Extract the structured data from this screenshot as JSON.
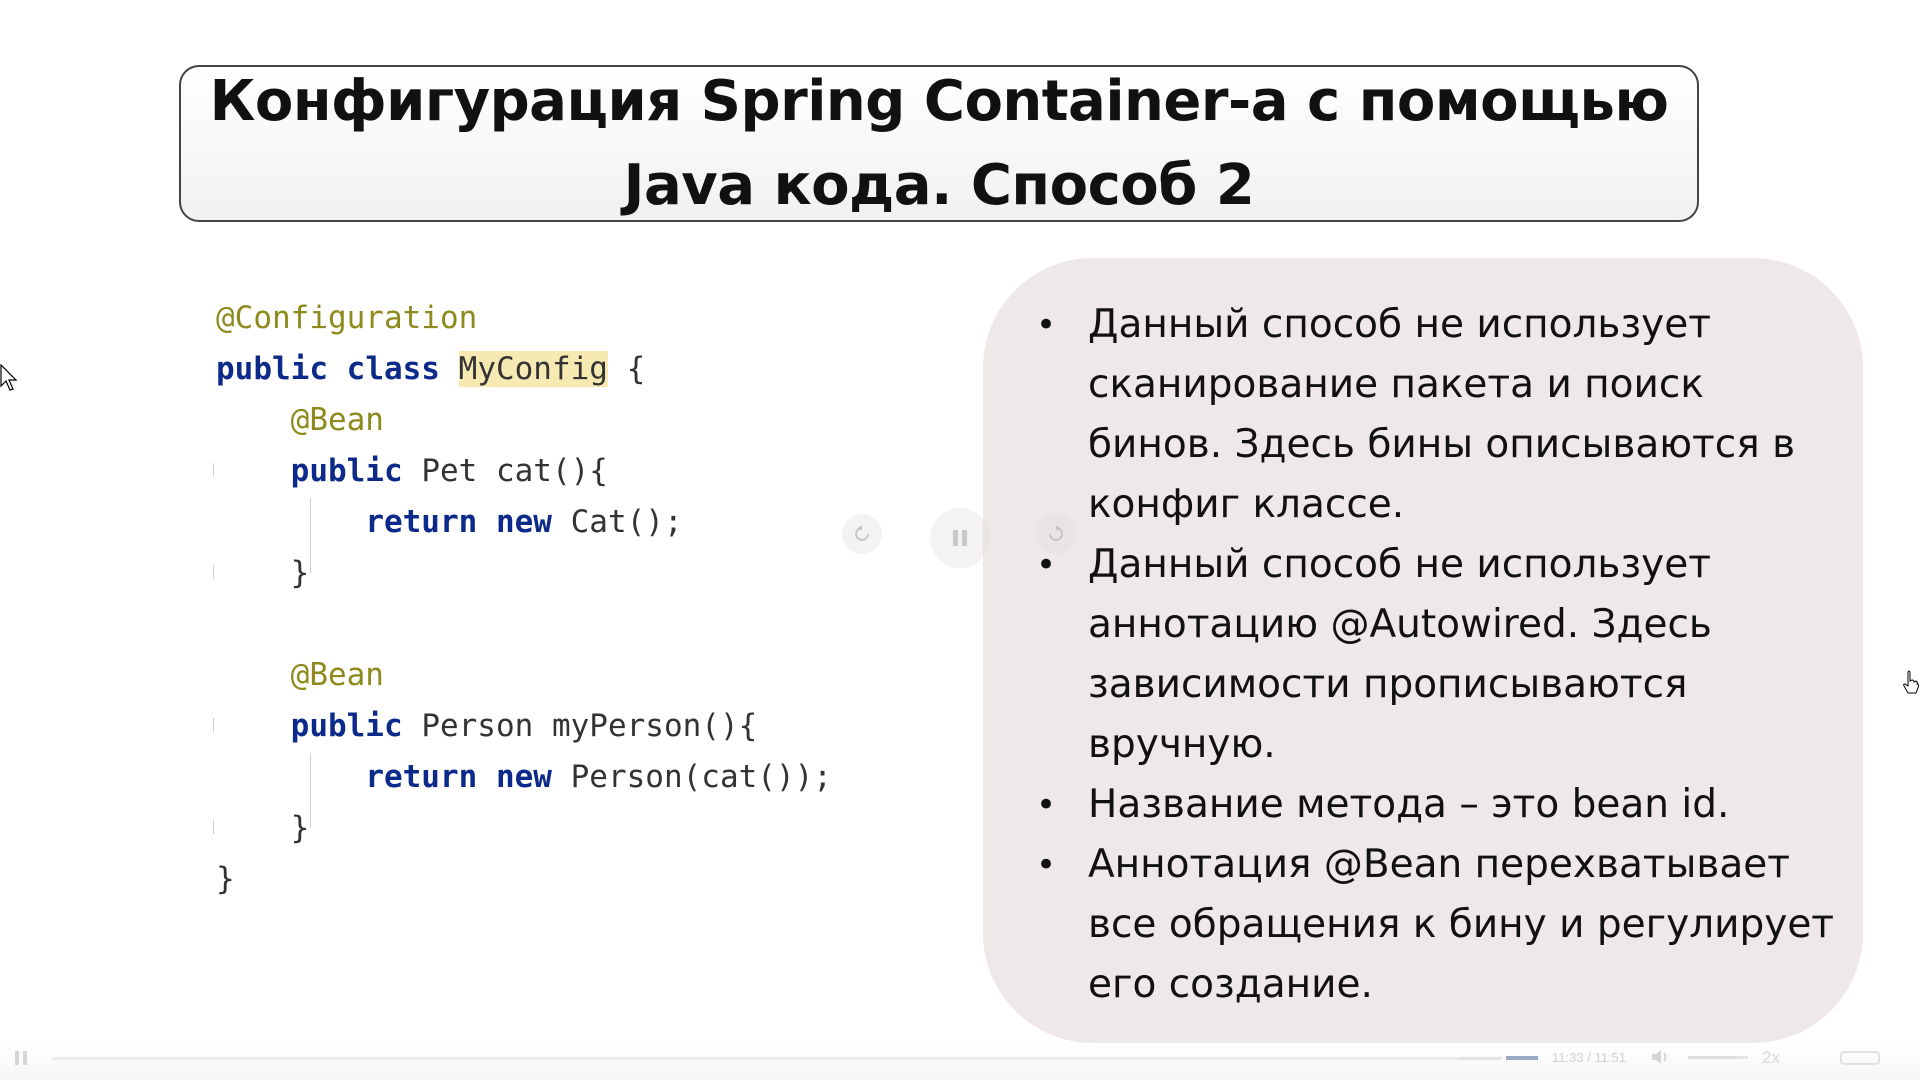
{
  "slide": {
    "title": "Конфигурация Spring Container-а с помощью\nJava кода. Способ 2",
    "code": {
      "annotation_configuration": "@Configuration",
      "kw_public": "public",
      "kw_class": "class",
      "class_name": "MyConfig",
      "open_brace": "{",
      "annotation_bean": "@Bean",
      "pet_type": "Pet",
      "method_cat": "cat(){",
      "kw_return": "return",
      "kw_new": "new",
      "cat_ctor": "Cat();",
      "close_brace": "}",
      "person_type": "Person",
      "method_person": "myPerson(){",
      "person_ctor": "Person(cat());"
    },
    "bullets": [
      "Данный способ не использует сканирование пакета и поиск бинов. Здесь бины описываются в конфиг классе.",
      "Данный способ не использует аннотацию @Autowired. Здесь зависимости прописываются вручную.",
      "Название метода – это bean id.",
      "Аннотация @Bean перехватывает все обращения к бину и регулирует его создание."
    ],
    "bullet_symbol": "•"
  },
  "player": {
    "current_time": "11:33",
    "separator": "/",
    "duration": "11:51",
    "speed": "2x",
    "progress": 0.97,
    "volume": 0.8,
    "icons": {
      "play_pause": "pause-icon",
      "volume": "volume-icon",
      "rewind": "rewind-icon",
      "forward": "forward-icon",
      "fullscreen": "fullscreen-icon"
    }
  },
  "colors": {
    "annotation": "#8e8a1e",
    "keyword": "#0c2a8a",
    "highlight": "#f6e9b2",
    "panel": "#efe8e8"
  }
}
